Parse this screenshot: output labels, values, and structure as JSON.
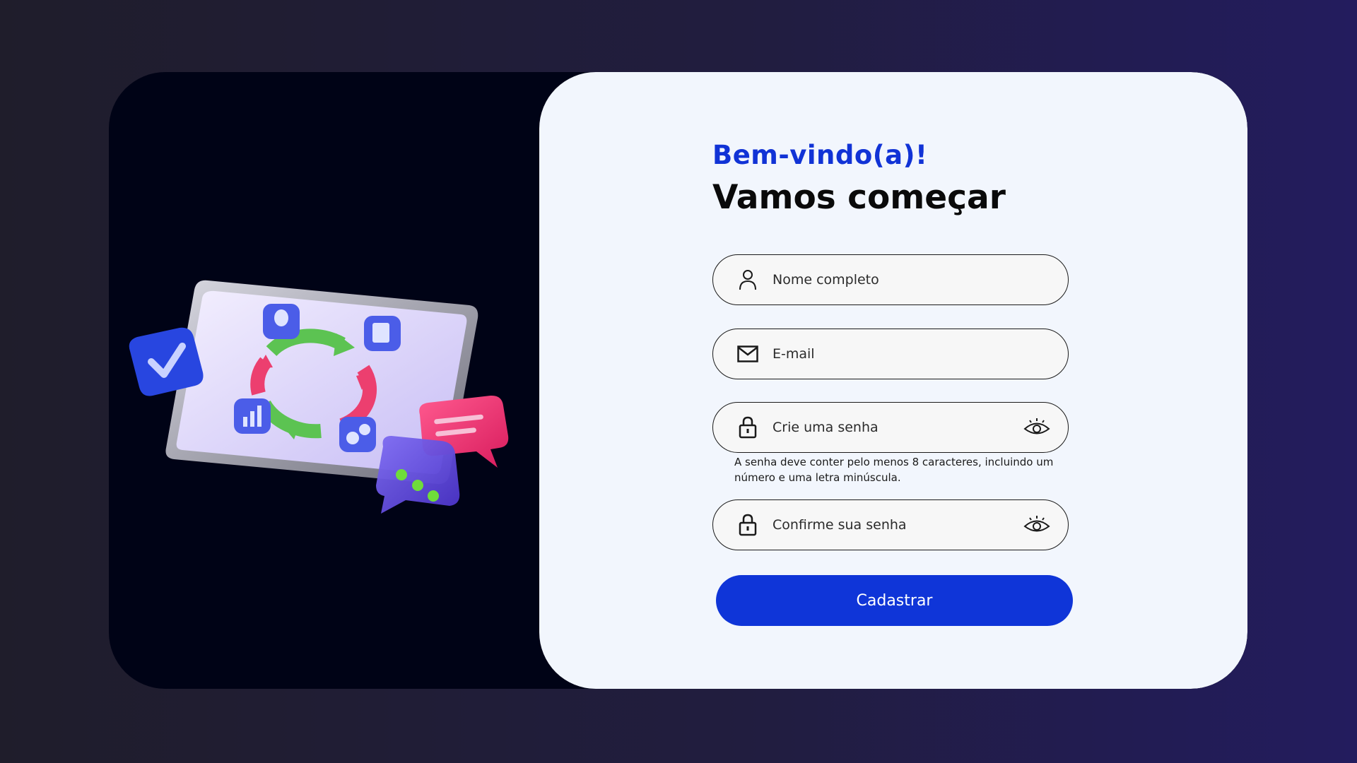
{
  "form": {
    "welcome": "Bem-vindo(a)!",
    "title": "Vamos começar",
    "fields": {
      "name": {
        "placeholder": "Nome completo",
        "icon": "user-icon"
      },
      "email": {
        "placeholder": "E-mail",
        "icon": "mail-icon"
      },
      "password": {
        "placeholder": "Crie uma senha",
        "icon": "lock-icon",
        "toggle_icon": "eye-icon"
      },
      "confirm": {
        "placeholder": "Confirme sua senha",
        "icon": "lock-icon",
        "toggle_icon": "eye-icon"
      }
    },
    "password_hint": "A senha deve conter pelo menos 8 caracteres, incluindo um número e uma letra minúscula.",
    "submit_label": "Cadastrar"
  },
  "colors": {
    "accent": "#1133d6",
    "button": "#0f35d8",
    "panel": "#f2f6fd",
    "dark_panel": "#000316"
  }
}
